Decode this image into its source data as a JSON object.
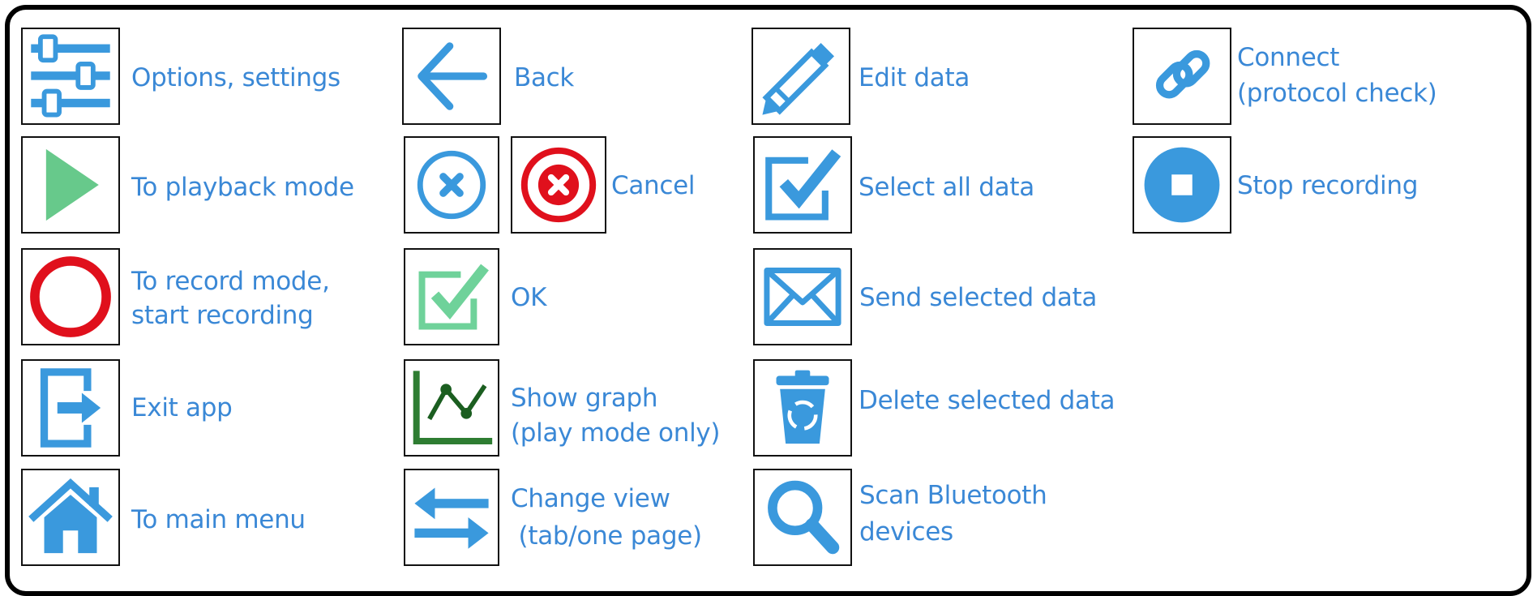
{
  "colors": {
    "label_blue": "#3a88d6",
    "icon_blue": "#3a99dd",
    "green_play": "#67c98b",
    "green_ok": "#6fd29a",
    "green_graph": "#2e7d32",
    "red": "#e0101c"
  },
  "legend": [
    {
      "icon": "sliders-icon",
      "label": "Options, settings"
    },
    {
      "icon": "back-arrow-icon",
      "label": "Back"
    },
    {
      "icon": "pencil-icon",
      "label": "Edit data"
    },
    {
      "icon": "link-icon",
      "label_lines": [
        "Connect",
        "(protocol check)"
      ]
    },
    {
      "icon": "play-icon",
      "label": "To playback mode"
    },
    {
      "icons": [
        "cancel-circle-blue-icon",
        "cancel-circle-red-icon"
      ],
      "label": "Cancel"
    },
    {
      "icon": "checkbox-icon",
      "label": "Select all data"
    },
    {
      "icon": "stop-icon",
      "label": "Stop recording"
    },
    {
      "icon": "record-ring-icon",
      "label_lines": [
        "To record mode,",
        "start recording"
      ]
    },
    {
      "icon": "ok-check-icon",
      "label": "OK"
    },
    {
      "icon": "envelope-icon",
      "label": "Send selected data"
    },
    {
      "icon": "exit-icon",
      "label": "Exit app"
    },
    {
      "icon": "graph-icon",
      "label_lines": [
        "Show graph",
        "(play mode only)"
      ]
    },
    {
      "icon": "trash-recycle-icon",
      "label": "Delete selected data"
    },
    {
      "icon": "home-icon",
      "label": "To main menu"
    },
    {
      "icon": "swap-arrows-icon",
      "label_lines": [
        "Change view",
        " (tab/one page)"
      ]
    },
    {
      "icon": "magnifier-icon",
      "label_lines": [
        "Scan Bluetooth",
        "devices"
      ]
    }
  ]
}
